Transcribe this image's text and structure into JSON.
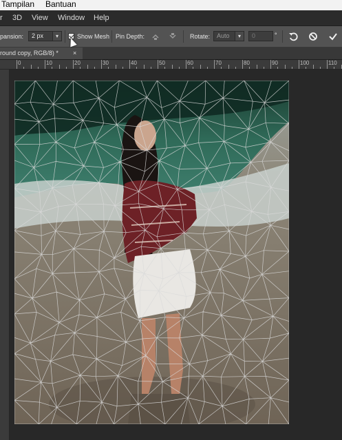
{
  "os_menu": {
    "tampilan": "Tampilan",
    "bantuan": "Bantuan"
  },
  "app_menu": {
    "partial": "r",
    "threed": "3D",
    "view": "View",
    "window": "Window",
    "help": "Help"
  },
  "options_bar": {
    "expansion_label": "pansion:",
    "expansion_value": "2 px",
    "show_mesh_label": "Show Mesh",
    "show_mesh_checked": true,
    "pin_depth_label": "Pin Depth:",
    "rotate_label": "Rotate:",
    "rotate_value": "Auto",
    "angle_value": "0",
    "degree_symbol": "°"
  },
  "document_tab": {
    "title": "round copy, RGB/8) *",
    "close": "×"
  },
  "ruler": {
    "top_labels": [
      "0",
      "10",
      "20",
      "30",
      "40",
      "50",
      "60",
      "70",
      "80",
      "90",
      "100",
      "110"
    ]
  },
  "icons": {
    "dropdown": "chevron-down-icon",
    "pin_forward": "pin-forward-icon",
    "pin_backward": "pin-backward-icon",
    "undo": "undo-icon",
    "cancel": "cancel-icon",
    "commit": "checkmark-icon",
    "cursor": "mouse-pointer-icon"
  },
  "colors": {
    "menubar": "#2b2b2b",
    "options": "#535353",
    "canvas_bg": "#282828",
    "mesh": "#d9d9d9"
  }
}
